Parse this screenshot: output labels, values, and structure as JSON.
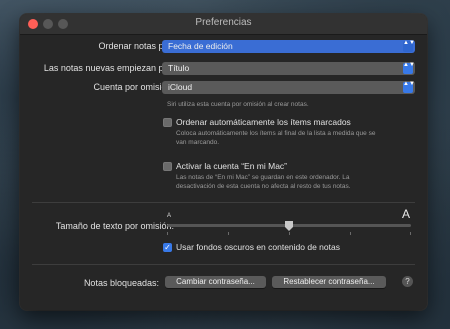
{
  "window": {
    "title": "Preferencias"
  },
  "rows": {
    "sort_notes": {
      "label": "Ordenar notas por:",
      "value": "Fecha de edición"
    },
    "new_notes_start": {
      "label": "Las notas nuevas empiezan por:",
      "value": "Título"
    },
    "default_account": {
      "label": "Cuenta por omisión:",
      "value": "iCloud"
    }
  },
  "siri_help": "Siri utiliza esta cuenta por omisión al crear notas.",
  "auto_sort": {
    "label": "Ordenar automáticamente los ítems marcados",
    "checked": false,
    "help_line1": "Coloca automáticamente los ítems al final de la lista a medida que se",
    "help_line2": "van marcando."
  },
  "on_my_mac": {
    "label": "Activar la cuenta “En mi Mac”",
    "checked": false,
    "help_line1": "Las notas de “En mi Mac” se guardan en este ordenador. La",
    "help_line2": "desactivación de esta cuenta no afecta al resto de tus notas."
  },
  "text_size": {
    "label": "Tamaño de texto por omisión:",
    "small_glyph": "A",
    "large_glyph": "A",
    "level_fraction": 0.5
  },
  "dark_backgrounds": {
    "label": "Usar fondos oscuros en contenido de notas",
    "checked": true,
    "check_glyph": "✓"
  },
  "locked_notes": {
    "label": "Notas bloqueadas:",
    "change_password": "Cambiar contraseña...",
    "reset_password": "Restablecer contraseña...",
    "help_glyph": "?"
  },
  "glyphs": {
    "popup_arrows": "▲▼"
  },
  "colors": {
    "accent": "#3879e8",
    "window_bg": "#262626",
    "close": "#ff5f57"
  }
}
